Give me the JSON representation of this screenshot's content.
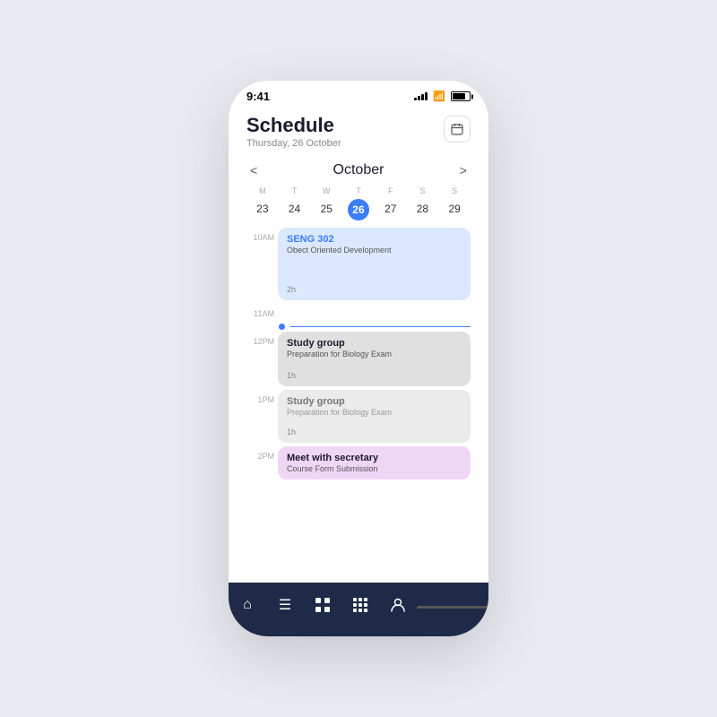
{
  "statusBar": {
    "time": "9:41",
    "signalBars": [
      3,
      5,
      7,
      9,
      11
    ],
    "wifi": "wifi",
    "battery": "battery"
  },
  "header": {
    "title": "Schedule",
    "subtitle": "Thursday, 26 October",
    "calendarIcon": "calendar-icon"
  },
  "monthNav": {
    "prev": "<",
    "month": "October",
    "next": ">"
  },
  "weekDays": {
    "headers": [
      "M",
      "T",
      "W",
      "T",
      "F",
      "S",
      "S"
    ],
    "numbers": [
      "23",
      "24",
      "25",
      "26",
      "27",
      "28",
      "29"
    ],
    "todayIndex": 3
  },
  "timeSlots": [
    {
      "label": "10AM"
    },
    {
      "label": "11AM"
    },
    {
      "label": "12PM"
    },
    {
      "label": "1PM"
    },
    {
      "label": "2PM"
    }
  ],
  "events": [
    {
      "id": "seng302",
      "title": "SENG 302",
      "subtitle": "Obect Oriented Development",
      "duration": "2h",
      "color": "blue",
      "titleColor": "blue-text"
    },
    {
      "id": "studygroup1",
      "title": "Study group",
      "subtitle": "Preparation for Biology Exam",
      "duration": "1h",
      "color": "gray",
      "titleColor": ""
    },
    {
      "id": "studygroup2",
      "title": "Study group",
      "subtitle": "Preparation for Biology Exam",
      "duration": "1h",
      "color": "gray-light",
      "titleColor": ""
    },
    {
      "id": "meetsecretary",
      "title": "Meet with secretary",
      "subtitle": "Course Form Submission",
      "duration": "",
      "color": "pink",
      "titleColor": ""
    }
  ],
  "bottomNav": {
    "items": [
      {
        "icon": "⌂",
        "name": "home"
      },
      {
        "icon": "☰",
        "name": "list"
      },
      {
        "icon": "▦",
        "name": "calendar-grid"
      },
      {
        "icon": "⊞",
        "name": "grid"
      },
      {
        "icon": "👤",
        "name": "profile"
      }
    ]
  }
}
